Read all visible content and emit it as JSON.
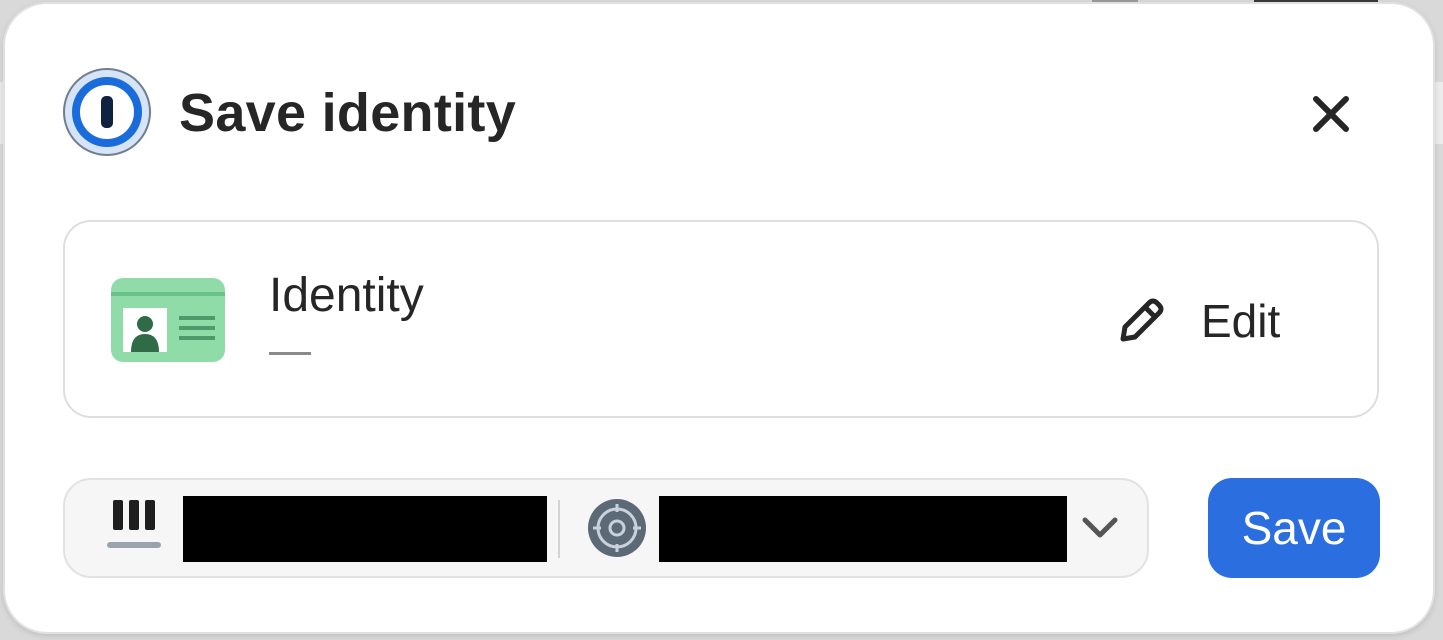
{
  "dialog": {
    "title": "Save identity",
    "app_logo_icon": "1password-logo-icon",
    "close_icon": "close-icon"
  },
  "item": {
    "type_icon": "identity-card-icon",
    "name": "Identity",
    "subtitle": "—",
    "edit_label": "Edit",
    "edit_icon": "pencil-icon"
  },
  "destination": {
    "account_icon": "piano-keys-icon",
    "account_name_redacted": true,
    "vault_icon": "vault-icon",
    "vault_name_redacted": true,
    "chevron_icon": "chevron-down-icon"
  },
  "actions": {
    "save_label": "Save"
  },
  "colors": {
    "primary": "#2a6ee0",
    "card_green": "#8fdca8",
    "card_dark_green": "#2e6b46"
  }
}
